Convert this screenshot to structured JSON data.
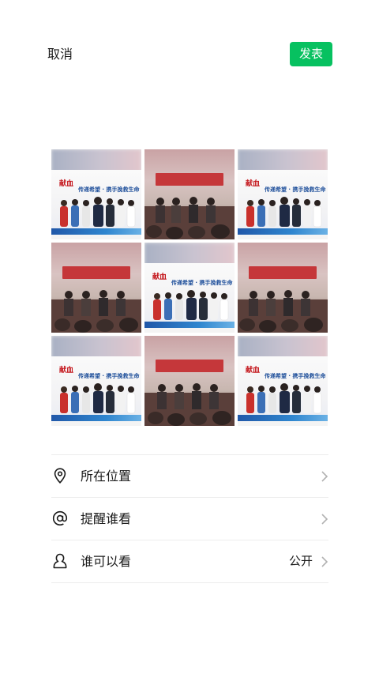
{
  "header": {
    "cancel_label": "取消",
    "publish_label": "发表"
  },
  "colors": {
    "accent": "#07c160",
    "divider": "#ededed",
    "text": "#1a1a1a",
    "chevron": "#b2b2b2"
  },
  "photos": {
    "tiles": [
      {
        "kind": "poster",
        "title": "献血",
        "subtitle": "传递希望 · 携手挽救生命"
      },
      {
        "kind": "meeting"
      },
      {
        "kind": "poster",
        "title": "献血",
        "subtitle": "传递希望 · 携手挽救生命"
      },
      {
        "kind": "meeting"
      },
      {
        "kind": "poster",
        "title": "献血",
        "subtitle": "传递希望 · 携手挽救生命"
      },
      {
        "kind": "meeting"
      },
      {
        "kind": "poster",
        "title": "献血",
        "subtitle": "传递希望 · 携手挽救生命"
      },
      {
        "kind": "meeting"
      },
      {
        "kind": "poster",
        "title": "献血",
        "subtitle": "传递希望 · 携手挽救生命"
      }
    ]
  },
  "options": {
    "location_label": "所在位置",
    "mention_label": "提醒谁看",
    "visibility_label": "谁可以看",
    "visibility_value": "公开"
  },
  "icons": {
    "location": "location-pin-icon",
    "mention": "at-sign-icon",
    "visibility": "person-icon",
    "chevron": "chevron-right-icon"
  }
}
